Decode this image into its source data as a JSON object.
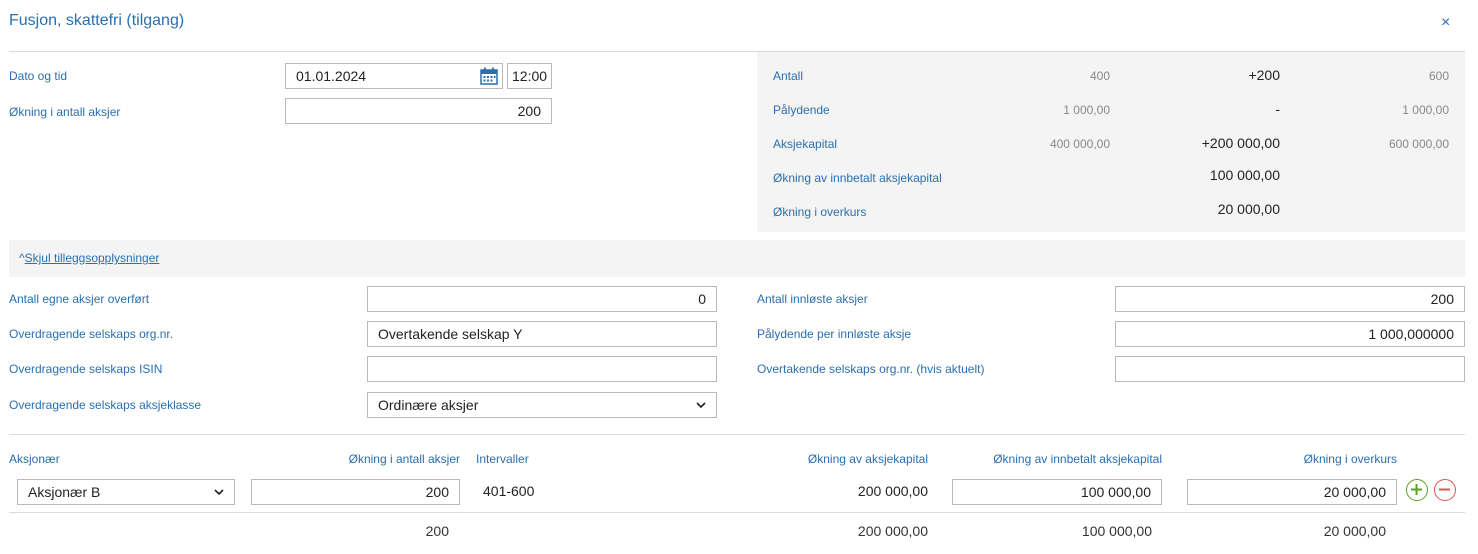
{
  "dialog": {
    "title": "Fusjon, skattefri (tilgang)",
    "close_glyph": "×"
  },
  "top_form": {
    "date_label": "Dato og tid",
    "date_value": "01.01.2024",
    "time_value": "12:00",
    "increase_label": "Økning i antall aksjer",
    "increase_value": "200"
  },
  "summary": {
    "rows": [
      {
        "label": "Antall",
        "before": "400",
        "delta": "+200",
        "after": "600"
      },
      {
        "label": "Pålydende",
        "before": "1 000,00",
        "delta": "-",
        "after": "1 000,00"
      },
      {
        "label": "Aksjekapital",
        "before": "400 000,00",
        "delta": "+200 000,00",
        "after": "600 000,00"
      },
      {
        "label": "Økning av innbetalt aksjekapital",
        "before": "",
        "delta": "100 000,00",
        "after": ""
      },
      {
        "label": "Økning i overkurs",
        "before": "",
        "delta": "20 000,00",
        "after": ""
      }
    ]
  },
  "extra": {
    "toggle_glyph": "^",
    "toggle_label": "Skjul tilleggsopplysninger",
    "left": [
      {
        "label": "Antall egne aksjer overført",
        "value": "0"
      },
      {
        "label": "Overdragende selskaps org.nr.",
        "value": "Overtakende selskap Y"
      },
      {
        "label": "Overdragende selskaps ISIN",
        "value": ""
      },
      {
        "label": "Overdragende selskaps aksjeklasse",
        "value": "Ordinære aksjer"
      }
    ],
    "right": [
      {
        "label": "Antall innløste aksjer",
        "value": "200"
      },
      {
        "label": "Pålydende per innløste aksje",
        "value": "1 000,000000"
      },
      {
        "label": "Overtakende selskaps org.nr. (hvis aktuelt)",
        "value": ""
      }
    ]
  },
  "table": {
    "headers": {
      "shareholder": "Aksjonær",
      "increase": "Økning i antall aksjer",
      "intervals": "Intervaller",
      "share_capital": "Økning av aksjekapital",
      "paid_in": "Økning av innbetalt aksjekapital",
      "premium": "Økning i overkurs"
    },
    "row": {
      "shareholder": "Aksjonær B",
      "increase": "200",
      "intervals": "401-600",
      "share_capital": "200 000,00",
      "paid_in": "100 000,00",
      "premium": "20 000,00"
    },
    "totals": {
      "increase": "200",
      "share_capital": "200 000,00",
      "paid_in": "100 000,00",
      "premium": "20 000,00"
    }
  },
  "colors": {
    "accent": "#2a6fb0",
    "add": "#5aa02c",
    "remove": "#d9534f",
    "panel": "#f4f4f4"
  },
  "icons": [
    "close-icon",
    "calendar-icon",
    "chevron-up-icon",
    "chevron-down-icon",
    "plus-icon",
    "minus-icon"
  ]
}
